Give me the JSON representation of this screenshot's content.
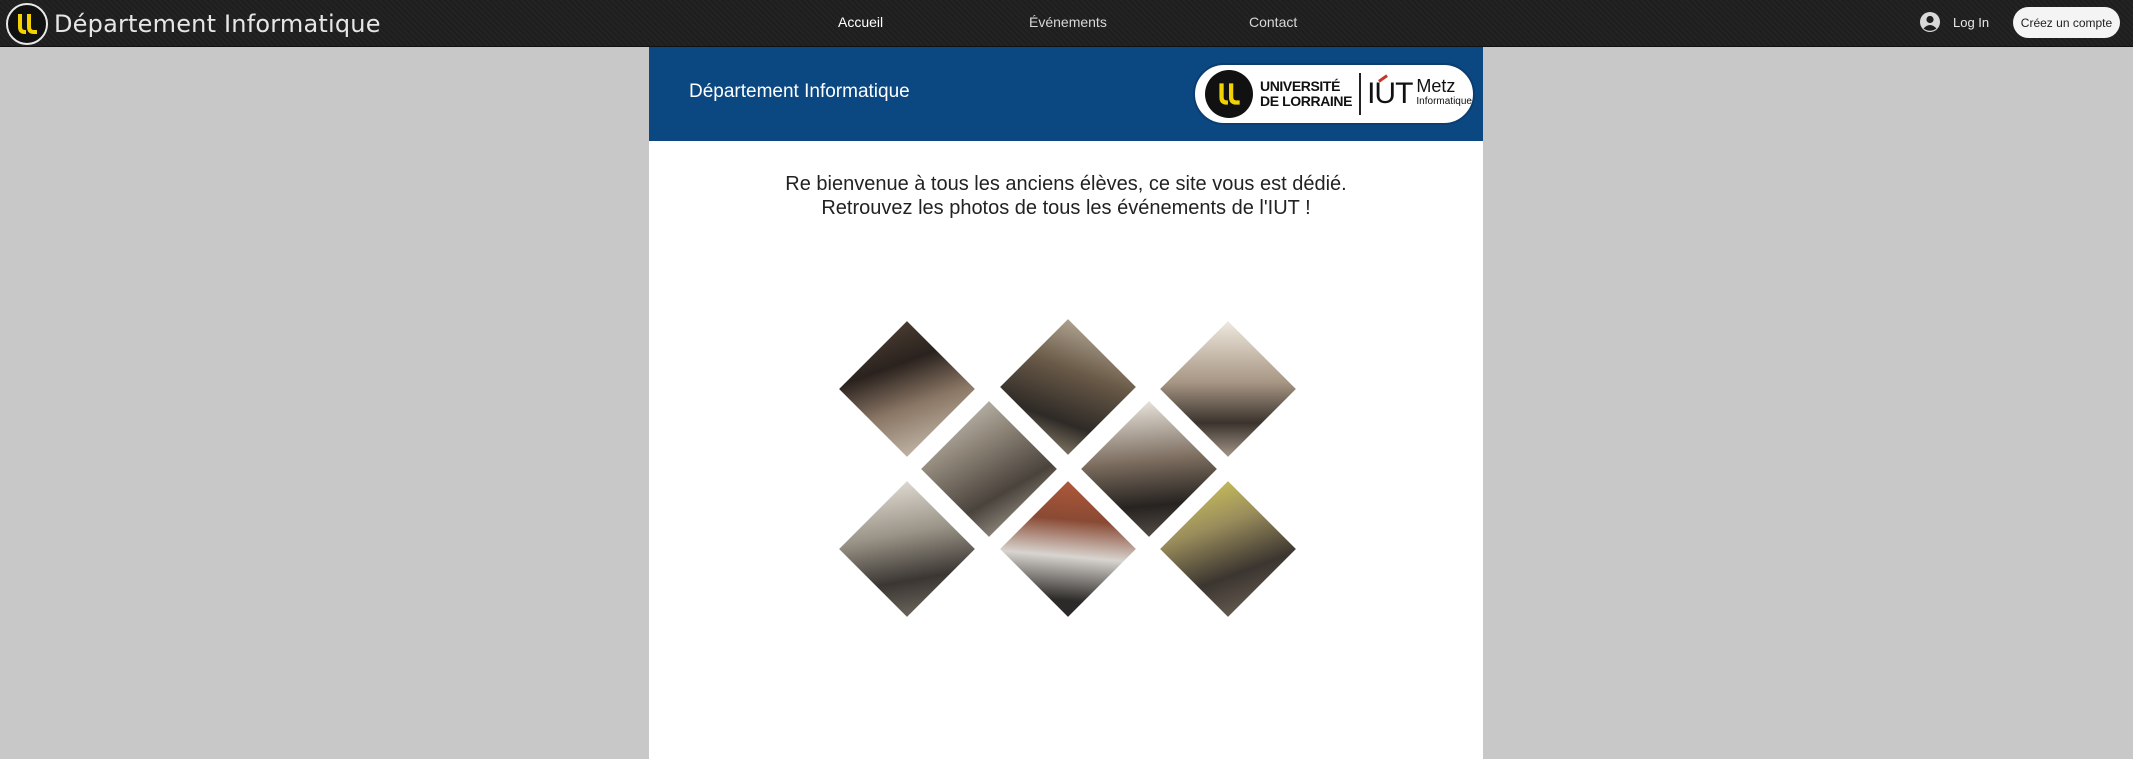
{
  "topbar": {
    "site_title": "Département Informatique",
    "nav": [
      {
        "label": "Accueil",
        "active": true
      },
      {
        "label": "Événements",
        "active": false
      },
      {
        "label": "Contact",
        "active": false
      }
    ],
    "login_label": "Log In",
    "signup_label": "Créez un compte",
    "logo_icon": "universite-de-lorraine-logo",
    "login_icon": "user-avatar-icon"
  },
  "header": {
    "title": "Département Informatique",
    "partner": {
      "ul_line1": "UNIVERSITÉ",
      "ul_line2": "DE LORRAINE",
      "iut_mark": "IUT",
      "city": "Metz",
      "dept": "Informatique"
    },
    "color": "#0b4780"
  },
  "welcome": {
    "line1": "Re bienvenue à tous les anciens élèves, ce site vous est dédié.",
    "line2": "Retrouvez les photos de tous les événements de l'IUT !"
  },
  "gallery": {
    "count": 8
  },
  "colors": {
    "topbar": "#1f1f1f",
    "page_background": "#c8c8c8",
    "ul_yellow": "#f2d300"
  }
}
